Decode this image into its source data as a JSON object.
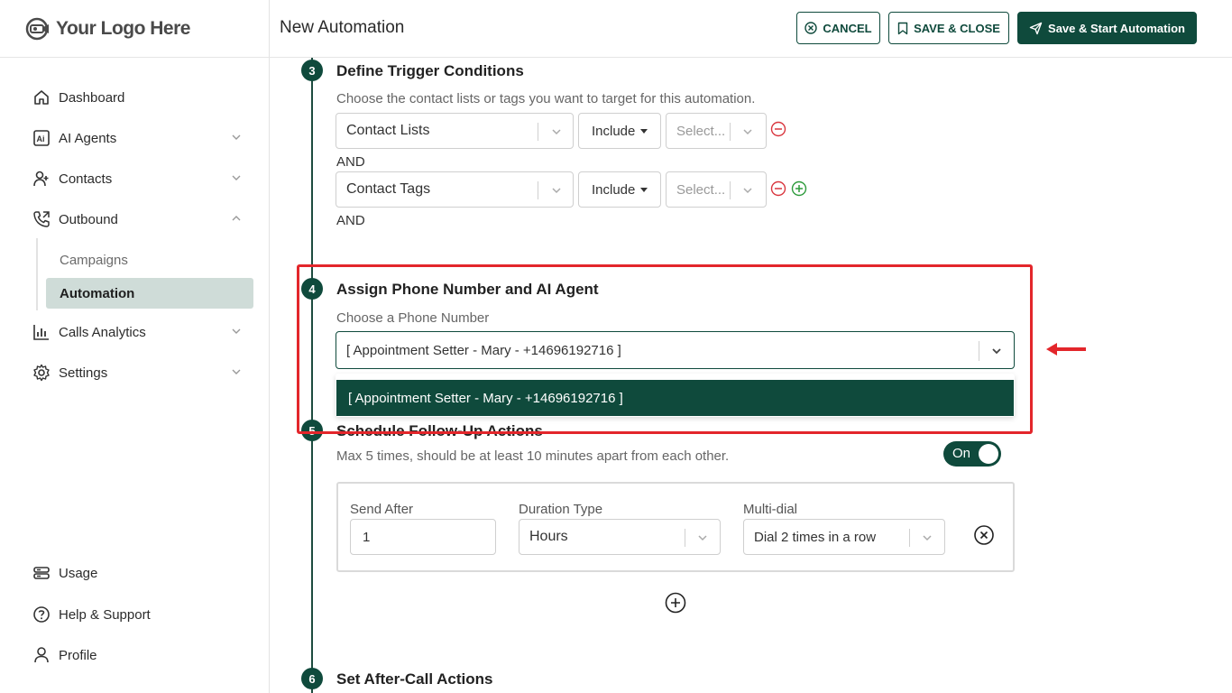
{
  "logo": {
    "text": "Your Logo Here"
  },
  "sidebar": {
    "items": [
      {
        "label": "Dashboard",
        "icon": "home-icon"
      },
      {
        "label": "AI Agents",
        "icon": "ai-agent-icon"
      },
      {
        "label": "Contacts",
        "icon": "contact-add-icon"
      },
      {
        "label": "Outbound",
        "icon": "phone-outgoing-icon"
      },
      {
        "label": "Calls Analytics",
        "icon": "bar-chart-icon"
      },
      {
        "label": "Settings",
        "icon": "gear-icon"
      }
    ],
    "subitems": [
      {
        "label": "Campaigns"
      },
      {
        "label": "Automation"
      }
    ],
    "bottom": [
      {
        "label": "Usage",
        "icon": "usage-icon"
      },
      {
        "label": "Help & Support",
        "icon": "help-icon"
      },
      {
        "label": "Profile",
        "icon": "user-icon"
      }
    ]
  },
  "header": {
    "title": "New Automation",
    "cancel_label": "CANCEL",
    "save_close_label": "SAVE & CLOSE",
    "save_start_label": "Save & Start Automation"
  },
  "steps": {
    "step3": {
      "number": "3",
      "title": "Define Trigger Conditions",
      "helper": "Choose the contact lists or tags you want to target for this automation.",
      "rows": [
        {
          "field": "Contact Lists",
          "operator": "Include",
          "value_placeholder": "Select..."
        },
        {
          "field": "Contact Tags",
          "operator": "Include",
          "value_placeholder": "Select..."
        }
      ],
      "and_label": "AND"
    },
    "step4": {
      "number": "4",
      "title": "Assign Phone Number and AI Agent",
      "field_label": "Choose a Phone Number",
      "selected_value": "[ Appointment Setter - Mary - +14696192716 ]",
      "dropdown_options": [
        "[ Appointment Setter - Mary - +14696192716 ]"
      ]
    },
    "step5": {
      "number": "5",
      "title": "Schedule Follow-Up Actions",
      "helper": "Max 5 times, should be at least 10 minutes apart from each other.",
      "toggle_label": "On",
      "toggle_on": true,
      "send_after_label": "Send After",
      "send_after_value": "1",
      "duration_type_label": "Duration Type",
      "duration_type_value": "Hours",
      "multi_dial_label": "Multi-dial",
      "multi_dial_value": "Dial 2 times in a row"
    },
    "step6": {
      "number": "6",
      "title": "Set After-Call Actions"
    }
  },
  "colors": {
    "brand": "#0f4a3c",
    "highlight": "#e3262b",
    "remove": "#d9363e",
    "add": "#2e9b3c"
  }
}
